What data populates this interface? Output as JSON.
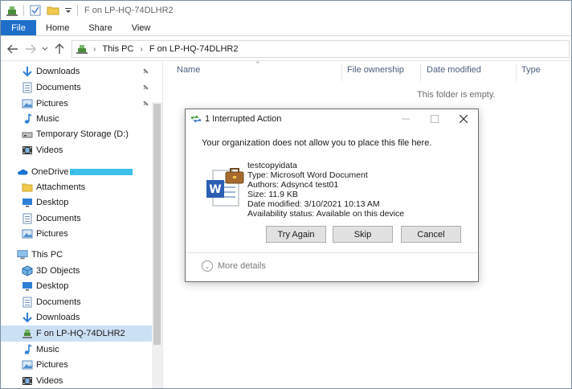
{
  "window": {
    "title": "F on LP-HQ-74DLHR2"
  },
  "ribbon": {
    "tabs": [
      "File",
      "Home",
      "Share",
      "View"
    ]
  },
  "address": {
    "crumbs": [
      "This PC",
      "F on LP-HQ-74DLHR2"
    ]
  },
  "nav": {
    "items": [
      {
        "label": "Downloads",
        "icon": "download-arrow-icon",
        "pinned": true
      },
      {
        "label": "Documents",
        "icon": "documents-icon",
        "pinned": true
      },
      {
        "label": "Pictures",
        "icon": "pictures-icon",
        "pinned": true
      },
      {
        "label": "Music",
        "icon": "music-note-icon"
      },
      {
        "label": "Temporary Storage (D:)",
        "icon": "drive-icon"
      },
      {
        "label": "Videos",
        "icon": "video-icon"
      },
      {
        "label": "OneDrive - ",
        "icon": "onedrive-cloud-icon"
      },
      {
        "label": "Attachments",
        "icon": "folder-icon"
      },
      {
        "label": "Desktop",
        "icon": "desktop-icon"
      },
      {
        "label": "Documents",
        "icon": "documents-icon"
      },
      {
        "label": "Pictures",
        "icon": "pictures-icon"
      },
      {
        "label": "This PC",
        "icon": "this-pc-icon"
      },
      {
        "label": "3D Objects",
        "icon": "3d-objects-icon"
      },
      {
        "label": "Desktop",
        "icon": "desktop-icon"
      },
      {
        "label": "Documents",
        "icon": "documents-icon"
      },
      {
        "label": "Downloads",
        "icon": "download-arrow-icon"
      },
      {
        "label": "F on LP-HQ-74DLHR2",
        "icon": "network-drive-icon",
        "selected": true
      },
      {
        "label": "Music",
        "icon": "music-note-icon"
      },
      {
        "label": "Pictures",
        "icon": "pictures-icon"
      },
      {
        "label": "Videos",
        "icon": "video-icon"
      }
    ]
  },
  "columns": [
    "Name",
    "File ownership",
    "Date modified",
    "Type"
  ],
  "content": {
    "empty_text": "This folder is empty."
  },
  "dialog": {
    "title": "1 Interrupted Action",
    "message": "Your organization does not allow you to place this file here.",
    "file": {
      "name": "testcopyidata",
      "type": "Type: Microsoft Word Document",
      "authors": "Authors: Adsync4 test01",
      "size": "Size: 11.9 KB",
      "date_modified": "Date modified: 3/10/2021 10:13 AM",
      "availability": "Availability status: Available on this device"
    },
    "buttons": {
      "try_again": "Try Again",
      "skip": "Skip",
      "cancel": "Cancel"
    },
    "more_details": "More details"
  }
}
